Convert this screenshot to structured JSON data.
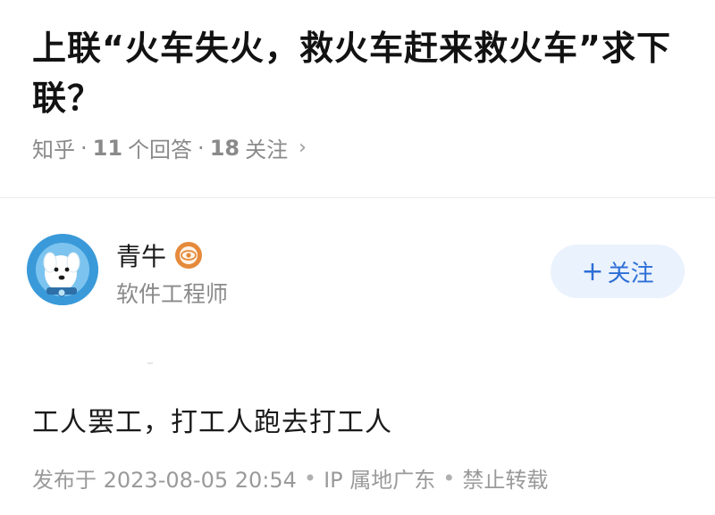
{
  "question": {
    "title": "上联“火车失火，救火车赶来救火车”求下联？",
    "source": "知乎",
    "answers_count": "11",
    "answers_label": "个回答",
    "followers_count": "18",
    "followers_label": "关注",
    "separator": "·"
  },
  "author": {
    "name": "青牛",
    "bio": "软件工程师",
    "follow_label": "关注",
    "follow_plus": "+"
  },
  "answer": {
    "content": "工人罢工，打工人跑去打工人",
    "published": "发布于 2023-08-05 20:54",
    "ip_location": "IP 属地广东",
    "repost_policy": "禁止转载",
    "separator": "•"
  },
  "colors": {
    "follow_bg": "#eaf2fd",
    "follow_text": "#2d6fd6",
    "badge": "#e58a3b",
    "avatar": "#3a9ad9"
  }
}
